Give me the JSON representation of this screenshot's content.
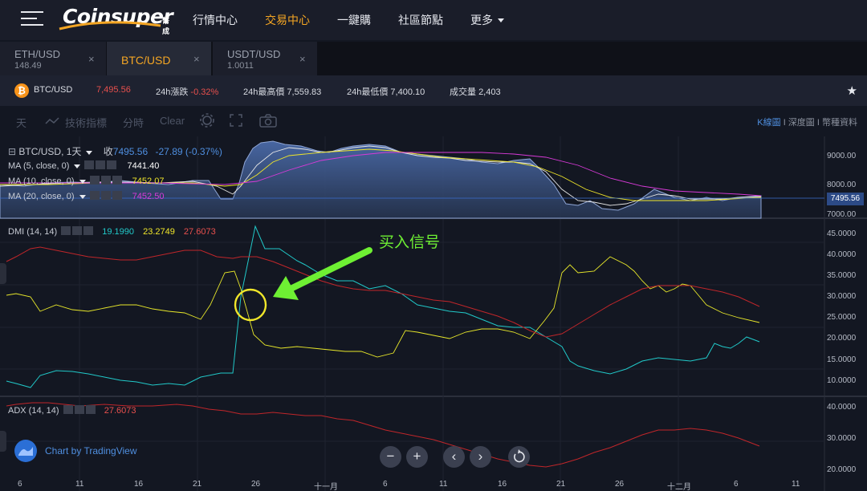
{
  "header": {
    "logo_text": "Coinsuper",
    "logo_sub": "幣成",
    "nav": [
      "行情中心",
      "交易中心",
      "一鍵購",
      "社區節點"
    ],
    "nav_more": "更多"
  },
  "tabs": [
    {
      "name": "ETH/USD",
      "price": "148.49",
      "close": "×"
    },
    {
      "name": "BTC/USD",
      "price": "",
      "close": "×"
    },
    {
      "name": "USDT/USD",
      "price": "1.0011",
      "close": "×"
    }
  ],
  "ticker": {
    "icon": "₿",
    "pair": "BTC/USD",
    "price": "7,495.56",
    "change_label": "24h漲跌",
    "change": "-0.32%",
    "high_label": "24h最高價",
    "high": "7,559.83",
    "low_label": "24h最低價",
    "low": "7,400.10",
    "volume_label": "成交量",
    "volume": "2,403",
    "star": "★"
  },
  "toolbar": {
    "interval": "天",
    "indicators": "技術指標",
    "timeline": "分時",
    "clear": "Clear",
    "views": {
      "kline": "K線圖",
      "depth": "深度圖",
      "info": "幣種資料",
      "sep": "I"
    }
  },
  "legends": {
    "symbol": "BTC/USD, 1天",
    "close_label": "收",
    "close": "7495.56",
    "change": "-27.89 (-0.37%)",
    "ma5": {
      "label": "MA (5, close, 0)",
      "value": "7441.40"
    },
    "ma10": {
      "label": "MA (10, close, 0)",
      "value": "7452.07"
    },
    "ma20": {
      "label": "MA (20, close, 0)",
      "value": "7452.50"
    },
    "dmi": {
      "label": "DMI (14, 14)",
      "v1": "19.1990",
      "v2": "23.2749",
      "v3": "27.6073"
    },
    "adx": {
      "label": "ADX (14, 14)",
      "value": "27.6073"
    }
  },
  "scales": {
    "price": [
      "9000.00",
      "8000.00",
      "7000.00"
    ],
    "price_tag": "7495.56",
    "dmi": [
      "45.0000",
      "40.0000",
      "35.0000",
      "30.0000",
      "25.0000",
      "20.0000",
      "15.0000",
      "10.0000"
    ],
    "adx": [
      "40.0000",
      "30.0000",
      "20.0000"
    ],
    "x": [
      "6",
      "11",
      "16",
      "21",
      "26",
      "十一月",
      "6",
      "11",
      "16",
      "21",
      "26",
      "十二月",
      "6",
      "11"
    ]
  },
  "annotation": {
    "text": "买入信号"
  },
  "branding": {
    "text": "Chart by TradingView"
  },
  "controls": {
    "zoom_out": "−",
    "zoom_in": "+",
    "prev": "‹",
    "next": "›"
  },
  "colors": {
    "accent": "#f5a623",
    "down": "#e8504d",
    "link": "#4f8fe0",
    "ma5": "#ffffff",
    "ma10": "#f0e62a",
    "ma20": "#d83ad8",
    "dmi_plus": "#21c9c9",
    "signal": "#6ef033"
  }
}
